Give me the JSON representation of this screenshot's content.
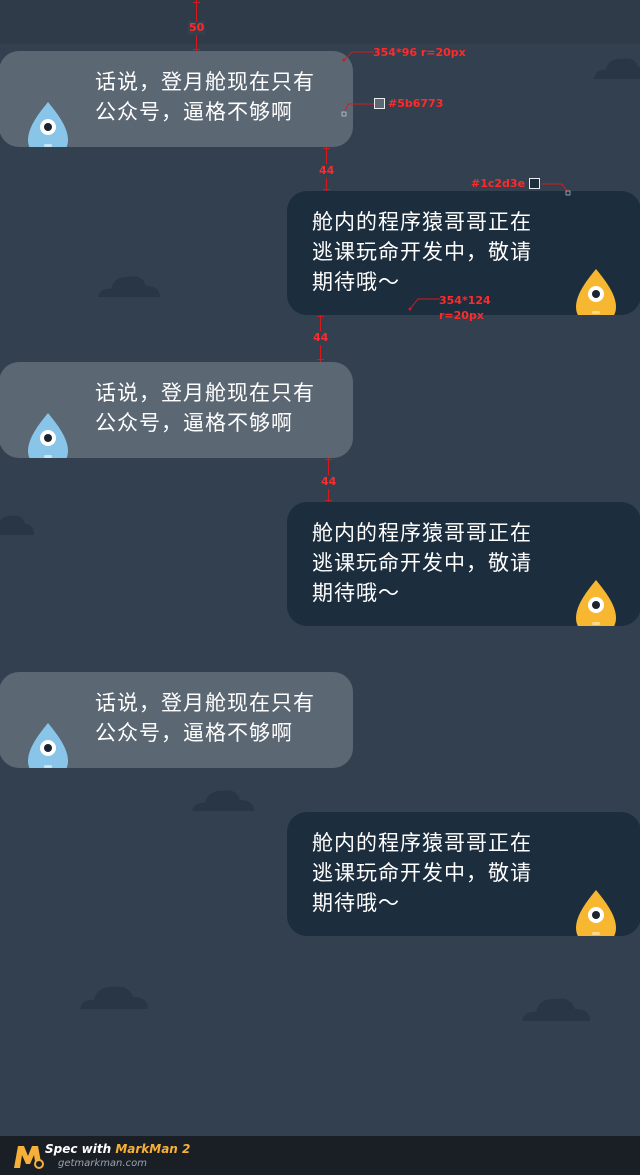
{
  "colors": {
    "background": "#33404f",
    "left_bubble": "#5b6773",
    "right_bubble": "#1c2d3e",
    "left_avatar": "#89c5e8",
    "right_avatar": "#f7b731",
    "annotation": "#ff2a2a"
  },
  "messages": [
    {
      "side": "left",
      "text": "话说，登月舱现在只有\n公众号，逼格不够啊",
      "avatar": "blue-blob-avatar"
    },
    {
      "side": "right",
      "text": "舱内的程序猿哥哥正在\n逃课玩命开发中，敬请\n期待哦～",
      "avatar": "yellow-blob-avatar"
    },
    {
      "side": "left",
      "text": "话说，登月舱现在只有\n公众号，逼格不够啊",
      "avatar": "blue-blob-avatar"
    },
    {
      "side": "right",
      "text": "舱内的程序猿哥哥正在\n逃课玩命开发中，敬请\n期待哦～",
      "avatar": "yellow-blob-avatar"
    },
    {
      "side": "left",
      "text": "话说，登月舱现在只有\n公众号，逼格不够啊",
      "avatar": "blue-blob-avatar"
    },
    {
      "side": "right",
      "text": "舱内的程序猿哥哥正在\n逃课玩命开发中，敬请\n期待哦～",
      "avatar": "yellow-blob-avatar"
    }
  ],
  "annotations": {
    "top_gap": "50",
    "left_size": "354*96  r=20px",
    "left_color": "#5b6773",
    "right_color": "#1c2d3e",
    "right_size": "354*124",
    "right_radius": "r=20px",
    "gap1": "44",
    "gap2": "44",
    "gap3": "44"
  },
  "footer": {
    "prefix": "Spec with ",
    "brand": "MarkMan 2",
    "url": "getmarkman.com"
  }
}
